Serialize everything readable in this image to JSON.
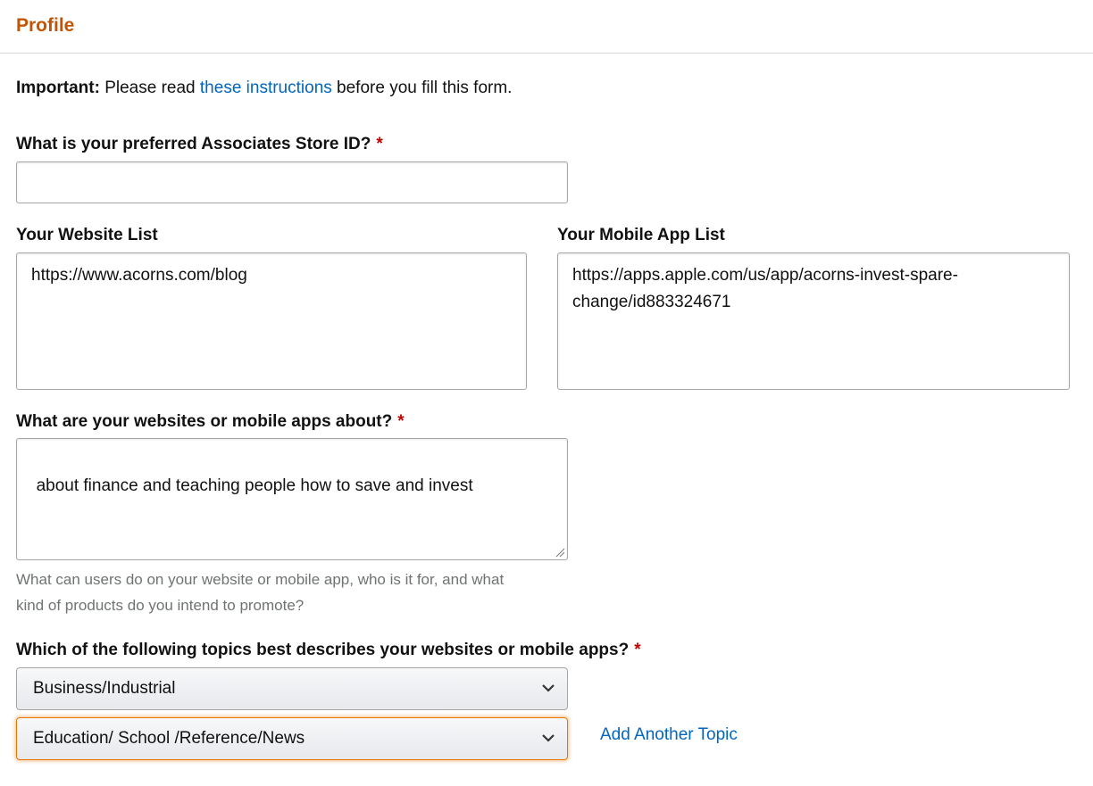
{
  "header": {
    "title": "Profile"
  },
  "important": {
    "prefix": "Important:",
    "text_before": " Please read ",
    "link": "these instructions",
    "text_after": " before you fill this form."
  },
  "store_id": {
    "label": "What is your preferred Associates Store ID?",
    "required_mark": "*",
    "value": ""
  },
  "website_list": {
    "label": "Your Website List",
    "value": "https://www.acorns.com/blog"
  },
  "app_list": {
    "label": "Your Mobile App List",
    "value": "https://apps.apple.com/us/app/acorns-invest-spare-change/id883324671"
  },
  "about": {
    "label": "What are your websites or mobile apps about?",
    "required_mark": "*",
    "value": "about finance and teaching people how to save and invest",
    "hint": "What can users do on your website or mobile app, who is it for, and what kind of products do you intend to promote?"
  },
  "topics": {
    "label": "Which of the following topics best describes your websites or mobile apps?",
    "required_mark": "*",
    "selects": [
      {
        "value": "Business/Industrial"
      },
      {
        "value": "Education/ School /Reference/News"
      }
    ],
    "add_link": "Add Another Topic"
  },
  "colors": {
    "header_title": "#c45500",
    "link": "#0066c0",
    "required": "#c40000",
    "focus": "#e77600"
  }
}
